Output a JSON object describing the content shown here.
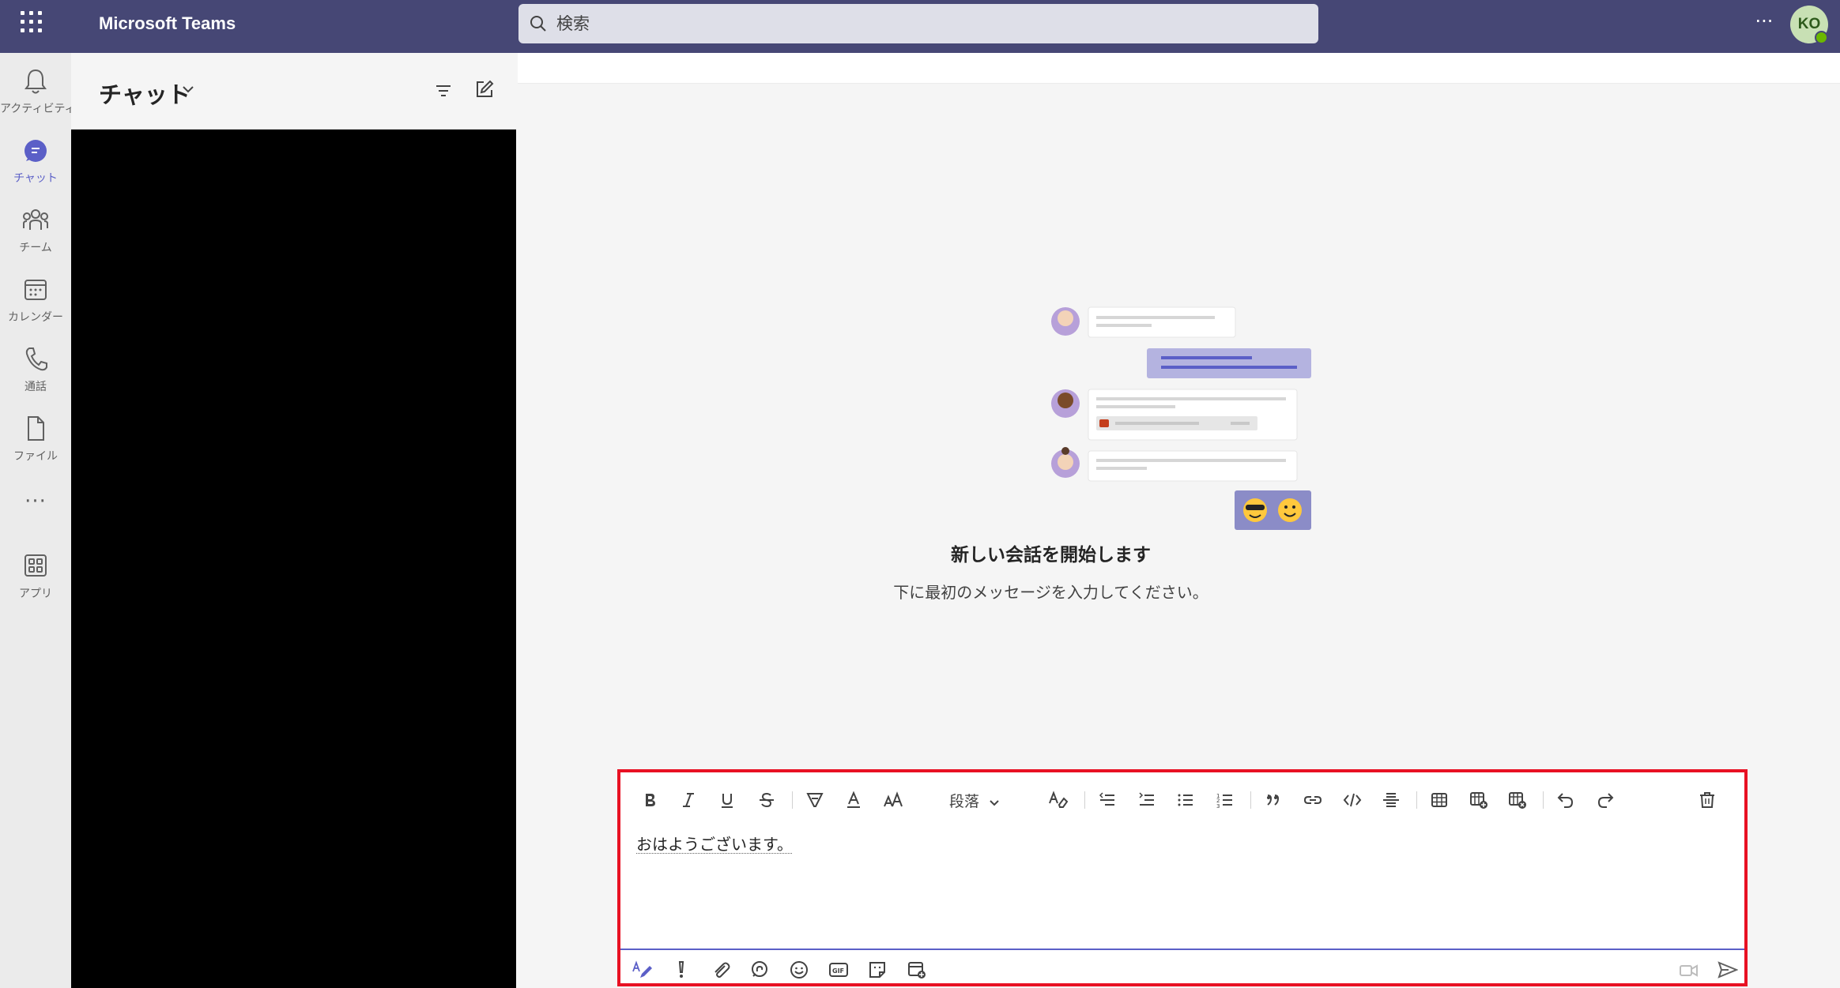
{
  "app": {
    "title": "Microsoft Teams",
    "user_initials": "KO",
    "accent_color": "#464775",
    "brand_purple": "#5b5fc7"
  },
  "search": {
    "placeholder": "検索"
  },
  "rail": {
    "items": [
      {
        "label": "アクティビティ",
        "icon": "bell-icon"
      },
      {
        "label": "チャット",
        "icon": "chat-icon",
        "active": true
      },
      {
        "label": "チーム",
        "icon": "teams-icon"
      },
      {
        "label": "カレンダー",
        "icon": "calendar-icon"
      },
      {
        "label": "通話",
        "icon": "phone-icon"
      },
      {
        "label": "ファイル",
        "icon": "file-icon"
      },
      {
        "label": "アプリ",
        "icon": "apps-icon"
      }
    ]
  },
  "chat_list": {
    "title": "チャット"
  },
  "main": {
    "new_conversation_title": "新しい会話を開始します",
    "new_conversation_subtitle": "下に最初のメッセージを入力してください。"
  },
  "composer": {
    "paragraph_style": "段落",
    "message_text": "おはようございます。",
    "highlight_color": "#e81123"
  }
}
